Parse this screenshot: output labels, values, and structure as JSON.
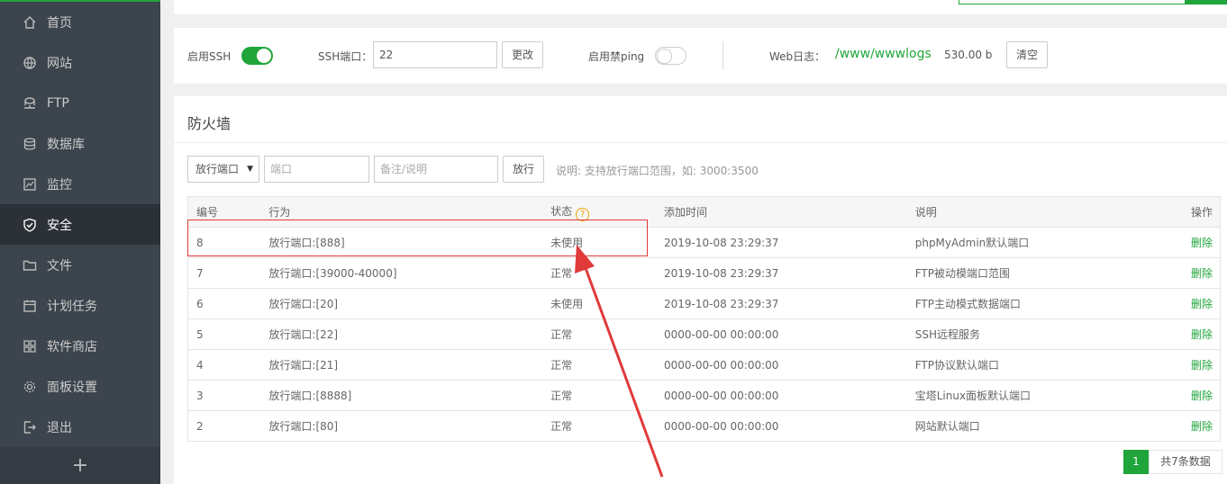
{
  "sidebar": {
    "items": [
      {
        "label": "首页",
        "icon": "home-icon"
      },
      {
        "label": "网站",
        "icon": "globe-icon"
      },
      {
        "label": "FTP",
        "icon": "ftp-icon"
      },
      {
        "label": "数据库",
        "icon": "database-icon"
      },
      {
        "label": "监控",
        "icon": "monitor-icon"
      },
      {
        "label": "安全",
        "icon": "shield-icon",
        "active": true
      },
      {
        "label": "文件",
        "icon": "folder-icon"
      },
      {
        "label": "计划任务",
        "icon": "calendar-icon"
      },
      {
        "label": "软件商店",
        "icon": "apps-icon"
      },
      {
        "label": "面板设置",
        "icon": "gear-icon"
      },
      {
        "label": "退出",
        "icon": "logout-icon"
      }
    ],
    "add_label": "+"
  },
  "ssh_bar": {
    "ssh_enable_label": "启用SSH",
    "ssh_enabled": true,
    "port_label": "SSH端口：",
    "port_value": "22",
    "change_button": "更改",
    "ping_label": "启用禁ping",
    "ping_enabled": false,
    "web_log_label": "Web日志：",
    "web_log_path": "/www/wwwlogs",
    "web_log_size": "530.00 b",
    "clear_button": "清空"
  },
  "firewall": {
    "title": "防火墙",
    "type_select": "放行端口",
    "port_placeholder": "端口",
    "note_placeholder": "备注/说明",
    "allow_button": "放行",
    "hint": "说明: 支持放行端口范围，如: 3000:3500",
    "columns": [
      "编号",
      "行为",
      "状态",
      "添加时间",
      "说明",
      "操作"
    ],
    "status_help": "?",
    "rows": [
      {
        "id": "8",
        "action": "放行端口:[888]",
        "status": "未使用",
        "time": "2019-10-08 23:29:37",
        "note": "phpMyAdmin默认端口",
        "op": "删除"
      },
      {
        "id": "7",
        "action": "放行端口:[39000-40000]",
        "status": "正常",
        "time": "2019-10-08 23:29:37",
        "note": "FTP被动模端口范围",
        "op": "删除"
      },
      {
        "id": "6",
        "action": "放行端口:[20]",
        "status": "未使用",
        "time": "2019-10-08 23:29:37",
        "note": "FTP主动模式数据端口",
        "op": "删除"
      },
      {
        "id": "5",
        "action": "放行端口:[22]",
        "status": "正常",
        "time": "0000-00-00 00:00:00",
        "note": "SSH远程服务",
        "op": "删除"
      },
      {
        "id": "4",
        "action": "放行端口:[21]",
        "status": "正常",
        "time": "0000-00-00 00:00:00",
        "note": "FTP协议默认端口",
        "op": "删除"
      },
      {
        "id": "3",
        "action": "放行端口:[8888]",
        "status": "正常",
        "time": "0000-00-00 00:00:00",
        "note": "宝塔Linux面板默认端口",
        "op": "删除"
      },
      {
        "id": "2",
        "action": "放行端口:[80]",
        "status": "正常",
        "time": "0000-00-00 00:00:00",
        "note": "网站默认端口",
        "op": "删除"
      }
    ],
    "pager": {
      "current": "1",
      "total": "共7条数据"
    }
  },
  "colors": {
    "accent": "#20a53a",
    "sidebar_bg": "#3c444d",
    "annotation_red": "#e03a3a"
  }
}
